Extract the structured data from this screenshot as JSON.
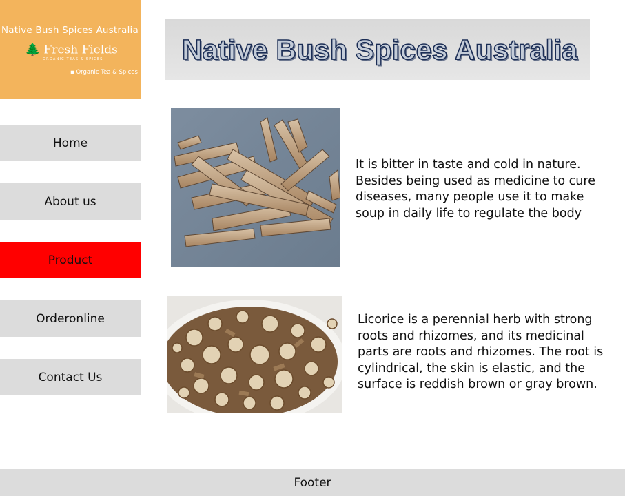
{
  "logo": {
    "top_text": "Native  Bush  Spices  Australia",
    "brand": "Fresh Fields",
    "sub": "ORGANIC TEAS & SPICES",
    "tag": "Organic Tea & Spices"
  },
  "nav": {
    "items": [
      {
        "label": "Home"
      },
      {
        "label": "About us"
      },
      {
        "label": "Product"
      },
      {
        "label": "Orderonline"
      },
      {
        "label": "Contact Us"
      }
    ],
    "active_color": "#ff0000"
  },
  "banner": {
    "title": "Native Bush Spices Australia"
  },
  "products": [
    {
      "description": "It is bitter in taste and cold in nature. Besides being used as medicine to cure diseases, many people use it to make soup in daily life to regulate the body"
    },
    {
      "description": "Licorice is a perennial herb with strong roots and rhizomes, and its medicinal parts are roots and rhizomes. The root is cylindrical, the skin is elastic, and the surface is reddish brown or gray brown."
    }
  ],
  "footer": {
    "label": "Footer"
  }
}
